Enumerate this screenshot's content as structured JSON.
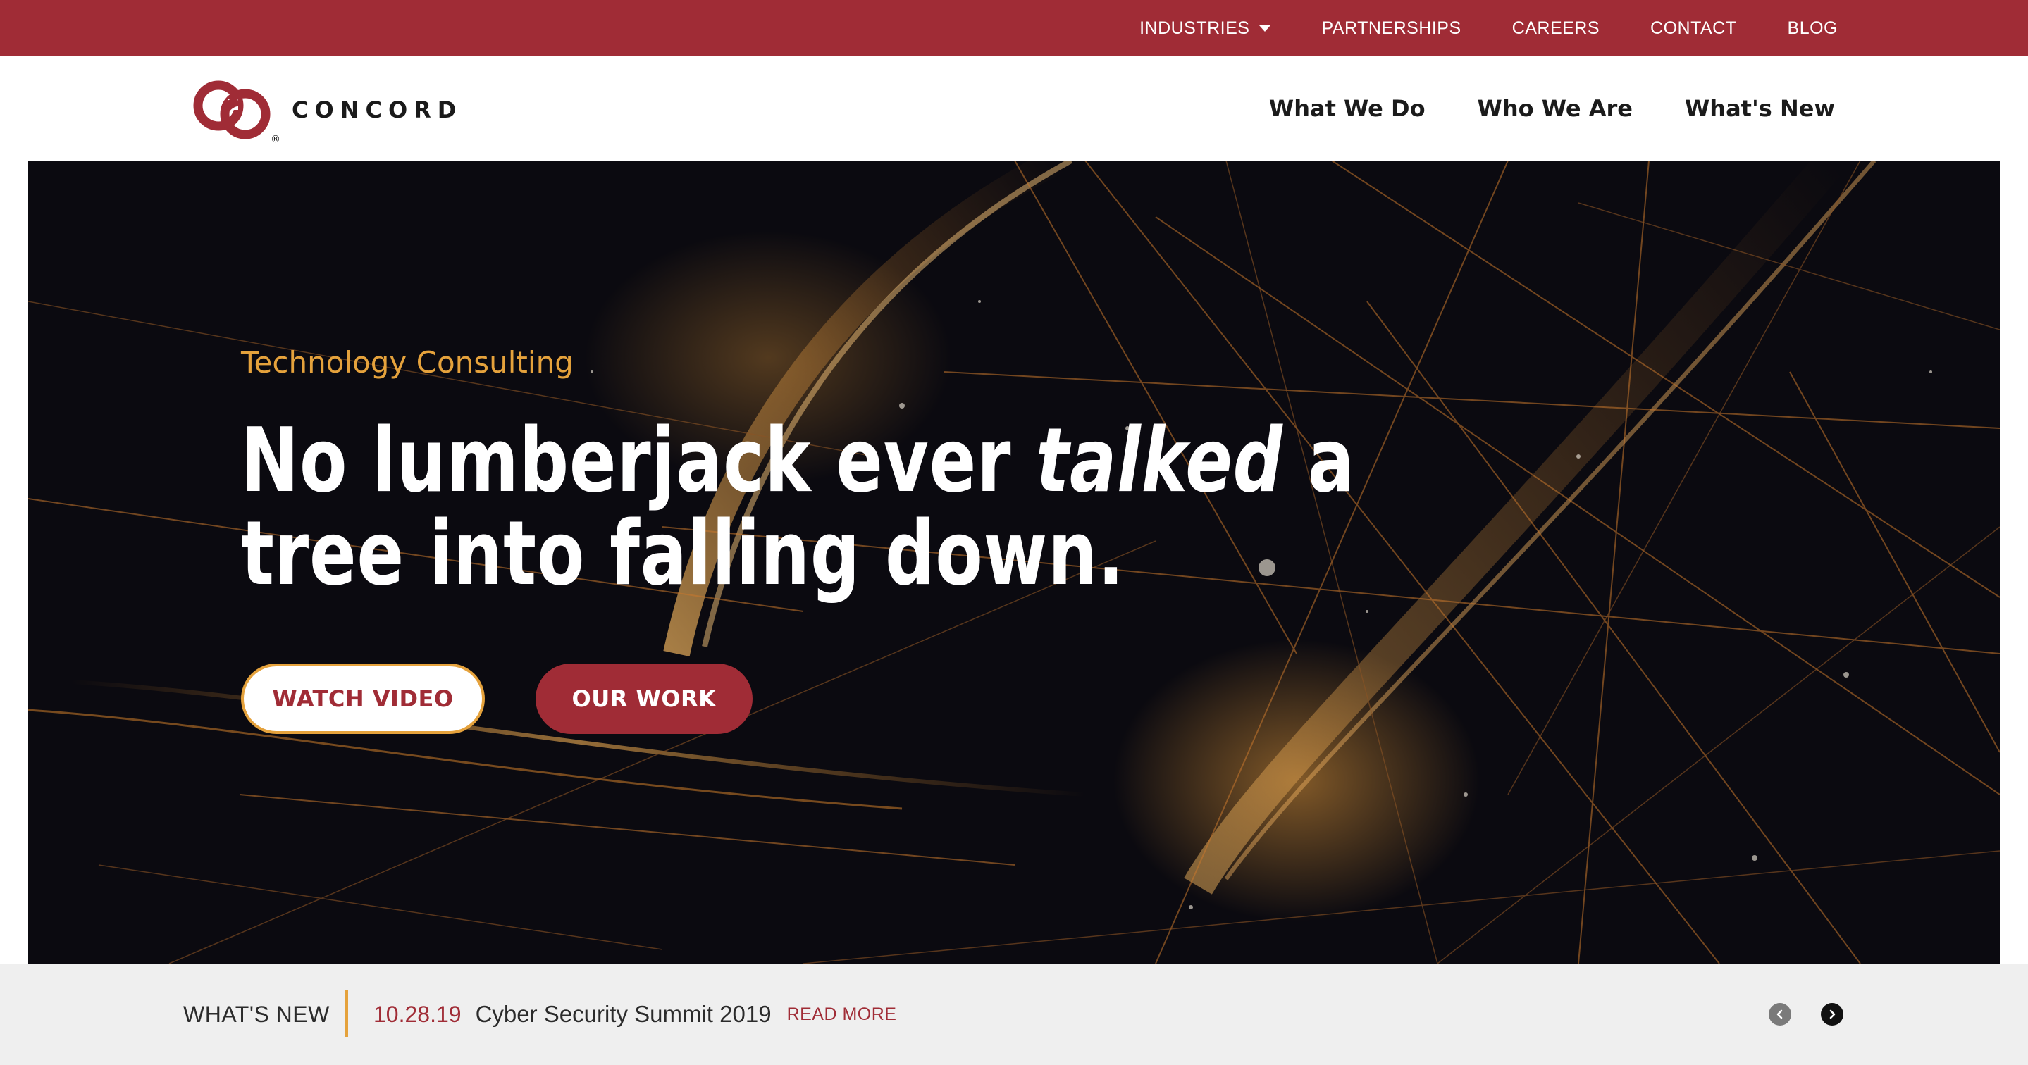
{
  "utility_nav": {
    "items": [
      {
        "label": "INDUSTRIES",
        "has_dropdown": true
      },
      {
        "label": "PARTNERSHIPS"
      },
      {
        "label": "CAREERS"
      },
      {
        "label": "CONTACT"
      },
      {
        "label": "BLOG"
      }
    ]
  },
  "brand": {
    "name": "CONCORD",
    "mark": "®"
  },
  "primary_nav": {
    "items": [
      "What We Do",
      "Who We Are",
      "What's New"
    ]
  },
  "hero": {
    "eyebrow": "Technology Consulting",
    "headline_line1_before": "No lumberjack ever ",
    "headline_emphasis": "talked",
    "headline_line1_after": " a",
    "headline_line2": "tree into falling down.",
    "buttons": {
      "watch_video": "WATCH VIDEO",
      "our_work": "OUR WORK"
    }
  },
  "news": {
    "label": "WHAT'S NEW",
    "date": "10.28.19",
    "title": "Cyber Security Summit 2019",
    "read_more": "READ MORE",
    "prev_icon": "chevron-left-icon",
    "next_icon": "chevron-right-icon"
  },
  "colors": {
    "brand_red": "#a02c36",
    "accent_gold": "#e5a23c",
    "hero_bg": "#0b0a10",
    "news_bg": "#efefef"
  }
}
